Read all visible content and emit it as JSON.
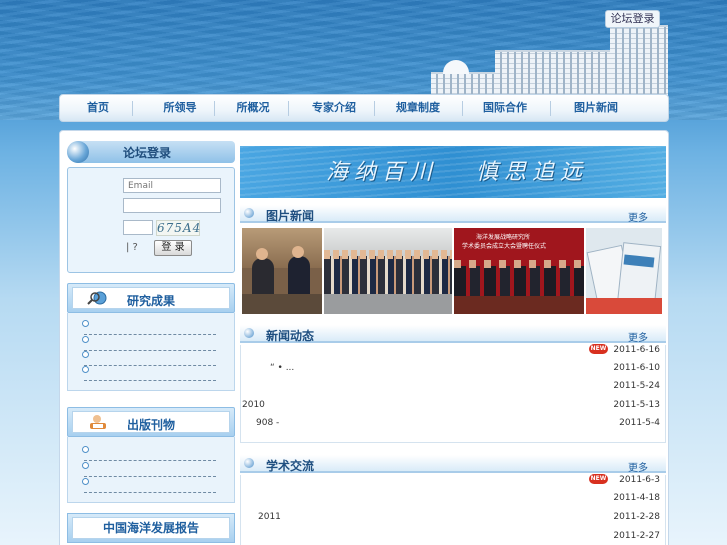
{
  "header": {
    "forum_login_btn": "论坛登录"
  },
  "nav": {
    "items": [
      "首页",
      "所领导",
      "所概况",
      "专家介绍",
      "规章制度",
      "国际合作",
      "图片新闻"
    ]
  },
  "login": {
    "title": "论坛登录",
    "email_placeholder": "Email",
    "captcha_text": "675A4",
    "links_text": "|  ?",
    "submit_label": "登 录"
  },
  "research": {
    "title": "研究成果",
    "items": [
      "",
      "",
      "",
      ""
    ]
  },
  "publications": {
    "title": "出版刊物",
    "items": [
      "",
      "",
      ""
    ]
  },
  "report": {
    "title": "中国海洋发展报告"
  },
  "banner": {
    "text_left": "海纳百川",
    "text_right": "慎思追远"
  },
  "photo_news": {
    "title": "图片新闻",
    "more": "更多",
    "photo3_caption_line1": "海洋发展战略研究所",
    "photo3_caption_line2": "学术委员会成立大会暨聘任仪式"
  },
  "news1": {
    "title": "新闻动态",
    "more": "更多",
    "rows": [
      {
        "text": "",
        "date": "2011-6-16",
        "is_new": true
      },
      {
        "text": "“    •   ...",
        "date": "2011-6-10",
        "is_new": false
      },
      {
        "text": "",
        "date": "2011-5-24",
        "is_new": false
      },
      {
        "text": "2010",
        "date": "2011-5-13",
        "is_new": false
      },
      {
        "text": "908 -",
        "date": "2011-5-4",
        "is_new": false
      }
    ]
  },
  "news2": {
    "title": "学术交流",
    "more": "更多",
    "rows": [
      {
        "text": "",
        "date": "2011-6-3",
        "is_new": true
      },
      {
        "text": "",
        "date": "2011-4-18",
        "is_new": false
      },
      {
        "text": "2011",
        "date": "2011-2-28",
        "is_new": false
      },
      {
        "text": "",
        "date": "2011-2-27",
        "is_new": false
      }
    ]
  },
  "badges": {
    "new_label": "NEW"
  },
  "colors": {
    "accent": "#1f5f9f",
    "sea": "#3f91d0",
    "new_badge": "#d8301f"
  }
}
